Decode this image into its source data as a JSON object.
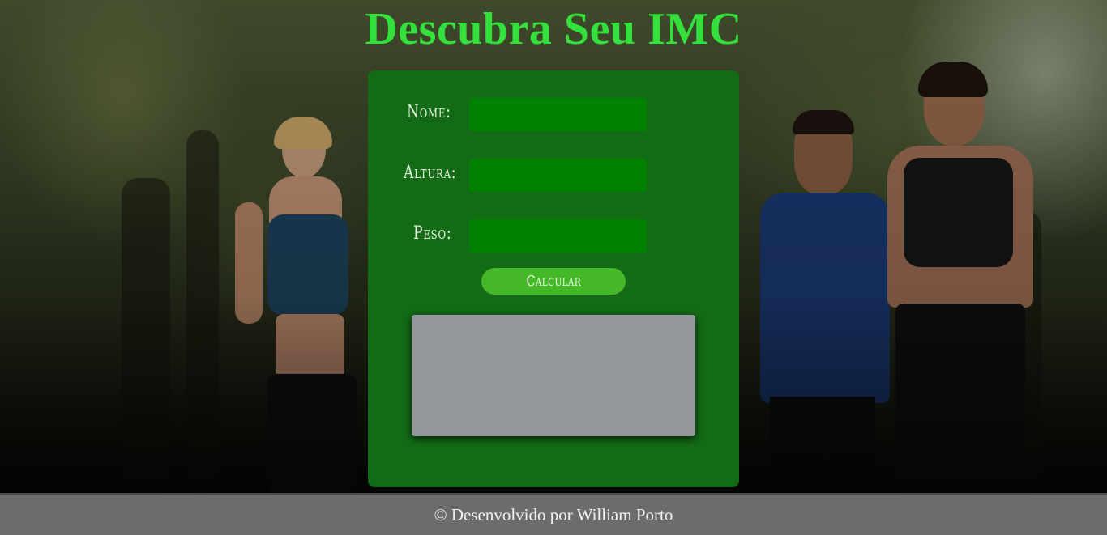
{
  "page": {
    "title": "Descubra Seu IMC"
  },
  "form": {
    "name_label": "Nome:",
    "height_label": "Altura:",
    "weight_label": "Peso:",
    "name_value": "",
    "height_value": "",
    "weight_value": "",
    "calculate_label": "Calcular"
  },
  "result": {
    "text": ""
  },
  "footer": {
    "text": "© Desenvolvido por William Porto"
  },
  "colors": {
    "title": "#33e03c",
    "card": "#136b16",
    "input": "#008200",
    "button": "#44b826",
    "result_box": "#94979b",
    "footer": "#6c6d6a"
  }
}
